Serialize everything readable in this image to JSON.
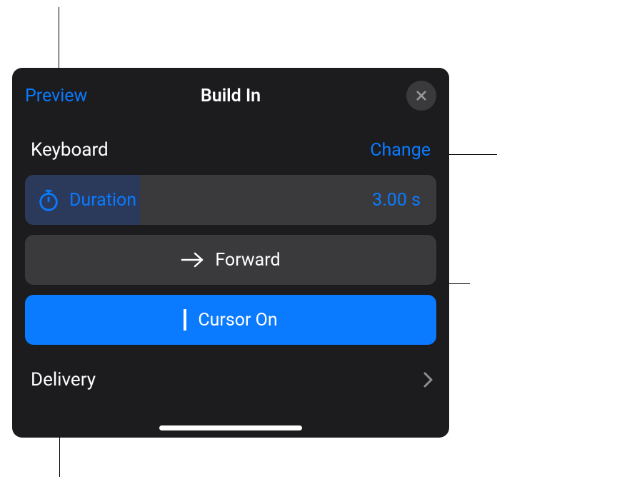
{
  "header": {
    "preview": "Preview",
    "title": "Build In"
  },
  "section": {
    "label": "Keyboard",
    "change": "Change"
  },
  "duration": {
    "label": "Duration",
    "value": "3.00 s"
  },
  "direction": {
    "label": "Forward"
  },
  "cursor": {
    "label": "Cursor On"
  },
  "delivery": {
    "label": "Delivery"
  }
}
